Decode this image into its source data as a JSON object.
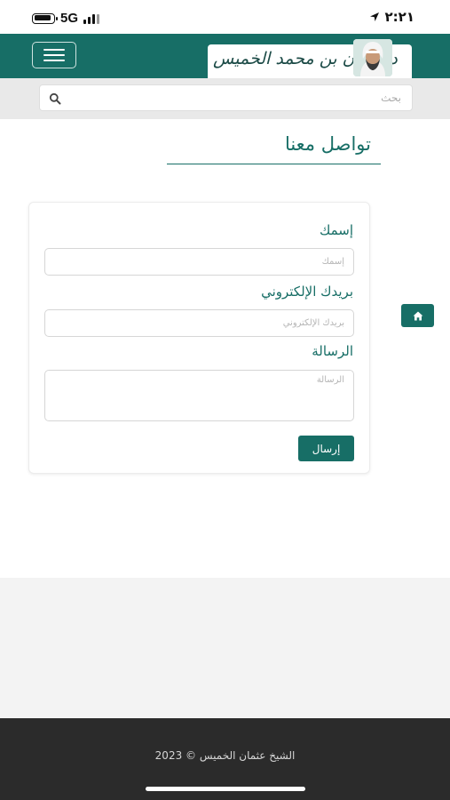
{
  "status_bar": {
    "time": "٢:٢١",
    "network": "5G",
    "battery_icon": "battery-icon",
    "signal_icon": "signal-bars-icon",
    "location_icon": "location-arrow-icon"
  },
  "header": {
    "menu_icon": "hamburger-menu-icon",
    "logo_text": "د.عثمان بن محمد الخميس",
    "avatar": "portrait-avatar"
  },
  "search": {
    "placeholder": "بحث",
    "icon": "search-icon"
  },
  "contact": {
    "title": "تواصل معنا",
    "home_icon": "home-icon",
    "name_label": "إسمك",
    "name_placeholder": "إسمك",
    "email_label": "بريدك الإلكتروني",
    "email_placeholder": "بريدك الإلكتروني",
    "message_label": "الرسالة",
    "message_placeholder": "الرسالة",
    "send_label": "إرسال"
  },
  "footer": {
    "copyright": "الشيخ عثمان الخميس © 2023"
  },
  "colors": {
    "primary": "#176e66",
    "footer_bg": "#2b2b2b",
    "search_bg": "#e9e9e9",
    "page_bg": "#f3f3f3"
  }
}
